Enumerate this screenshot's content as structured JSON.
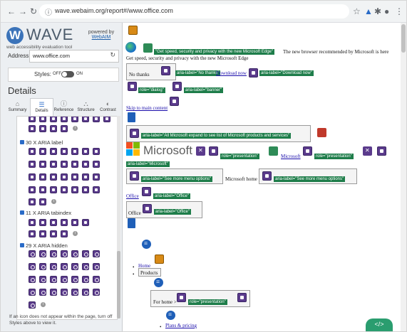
{
  "browser": {
    "url": "wave.webaim.org/report#/www.office.com"
  },
  "panel": {
    "logo_word": "WAVE",
    "logo_tagline": "web accessibility evaluation tool",
    "powered_by": "powered by",
    "powered_link": "WebAIM",
    "address_label": "Address:",
    "address_value": "www.office.com",
    "styles_label": "Styles:",
    "styles_off": "OFF",
    "styles_on": "ON",
    "details_heading": "Details",
    "tabs": [
      {
        "label": "Summary"
      },
      {
        "label": "Details"
      },
      {
        "label": "Reference"
      },
      {
        "label": "Structure"
      },
      {
        "label": "Contrast"
      }
    ],
    "groups": [
      {
        "label": "30 X ARIA label"
      },
      {
        "label": "11 X ARIA tabindex"
      },
      {
        "label": "29 X ARIA hidden"
      }
    ],
    "footer_note": "If an icon does not appear within the page, turn off Styles above to view it."
  },
  "content": {
    "edge_banner_aria": "\"Get speed, security and privacy with the new Microsoft Edge\"",
    "edge_banner_text": "The new browser recommended by Microsoft is here",
    "edge_banner_text2": "Get speed, security and privacy with the new Microsoft Edge",
    "no_thanks_label": "No thanks",
    "no_thanks_aria": "aria-label=\"No thanks\"",
    "download_link": "Download now",
    "download_aria": "aria-label=\"Download now\"",
    "role_dialog": "role=\"dialog\"",
    "banner_aria": "aria-label=\"banner\"",
    "skip_link": "Skip to main content",
    "expand_aria": "aria-label=\"All Microsoft expand to see list of Microsoft products and services\"",
    "ms_word": "Microsoft",
    "role_presentation": "role=\"presentation\"",
    "ms_link": "Microsoft",
    "aria_microsoft": "aria-label=\"Microsoft\"",
    "more_menu_aria": "aria-label=\"See more menu options\"",
    "ms_home": "Microsoft home",
    "office_link": "Office",
    "office_aria": "aria-label=\"Office\"",
    "office_label": "Office",
    "home_link": "Home",
    "products_label": "Products",
    "for_home_label": "For home >",
    "plans_link": "Plans & pricing",
    "code_tab": "</>"
  }
}
